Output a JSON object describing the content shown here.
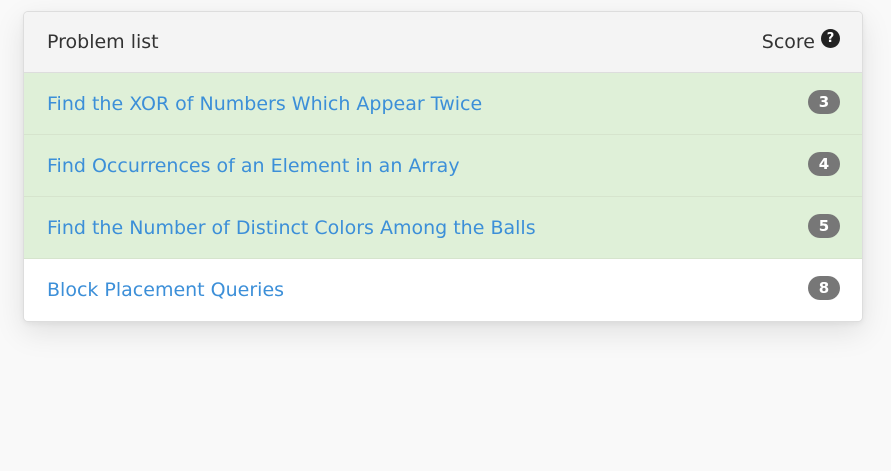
{
  "header": {
    "title": "Problem list",
    "score_label": "Score",
    "help_icon": "?"
  },
  "problems": [
    {
      "title": "Find the XOR of Numbers Which Appear Twice",
      "score": "3",
      "solved": true
    },
    {
      "title": "Find Occurrences of an Element in an Array",
      "score": "4",
      "solved": true
    },
    {
      "title": "Find the Number of Distinct Colors Among the Balls",
      "score": "5",
      "solved": true
    },
    {
      "title": "Block Placement Queries",
      "score": "8",
      "solved": false
    }
  ],
  "colors": {
    "solved_row": "#dff0d8",
    "link": "#3c8fd8",
    "badge": "#777777"
  }
}
